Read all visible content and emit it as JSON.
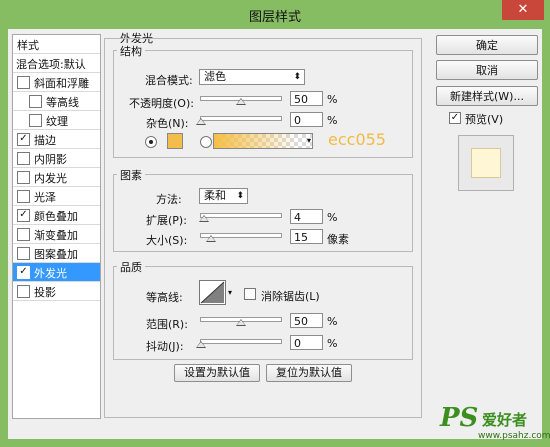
{
  "window": {
    "title": "图层样式",
    "close": "✕"
  },
  "left_list": {
    "header": "样式",
    "blend_default": "混合选项:默认",
    "items": [
      {
        "label": "斜面和浮雕",
        "checked": false,
        "indent": false,
        "mark": ""
      },
      {
        "label": "等高线",
        "checked": false,
        "indent": true,
        "mark": ""
      },
      {
        "label": "纹理",
        "checked": false,
        "indent": true,
        "mark": ""
      },
      {
        "label": "描边",
        "checked": true,
        "indent": false,
        "mark": "✓"
      },
      {
        "label": "内阴影",
        "checked": false,
        "indent": false,
        "mark": ""
      },
      {
        "label": "内发光",
        "checked": false,
        "indent": false,
        "mark": ""
      },
      {
        "label": "光泽",
        "checked": false,
        "indent": false,
        "mark": ""
      },
      {
        "label": "颜色叠加",
        "checked": true,
        "indent": false,
        "mark": "✓"
      },
      {
        "label": "渐变叠加",
        "checked": false,
        "indent": false,
        "mark": ""
      },
      {
        "label": "图案叠加",
        "checked": false,
        "indent": false,
        "mark": ""
      },
      {
        "label": "外发光",
        "checked": true,
        "indent": false,
        "mark": "✓",
        "selected": true
      },
      {
        "label": "投影",
        "checked": false,
        "indent": false,
        "mark": ""
      }
    ]
  },
  "outer_glow": {
    "title": "外发光",
    "structure": {
      "label": "结构",
      "blend_mode_label": "混合模式:",
      "blend_mode_value": "滤色",
      "opacity_label": "不透明度(O):",
      "opacity_value": "50",
      "opacity_unit": "%",
      "opacity_level": 0.5,
      "noise_label": "杂色(N):",
      "noise_value": "0",
      "noise_unit": "%",
      "noise_level": 0,
      "color_hex": "#f3bd4c",
      "watermark": "ecc055"
    },
    "elements": {
      "label": "图素",
      "technique_label": "方法:",
      "technique_value": "柔和",
      "spread_label": "扩展(P):",
      "spread_value": "4",
      "spread_unit": "%",
      "spread_level": 0.04,
      "size_label": "大小(S):",
      "size_value": "15",
      "size_unit": "像素"
    },
    "quality": {
      "label": "品质",
      "contour_label": "等高线:",
      "antialias_label": "消除锯齿(L)",
      "range_label": "范围(R):",
      "range_value": "50",
      "range_unit": "%",
      "range_level": 0.5,
      "jitter_label": "抖动(J):",
      "jitter_value": "0",
      "jitter_unit": "%",
      "jitter_level": 0
    },
    "set_default": "设置为默认值",
    "reset_default": "复位为默认值"
  },
  "right": {
    "ok": "确定",
    "cancel": "取消",
    "new_style": "新建样式(W)...",
    "preview_label": "预览(V)",
    "preview_checked": true
  },
  "branding": {
    "ps": "PS",
    "cn": "爱好者",
    "url": "www.psahz.com"
  }
}
